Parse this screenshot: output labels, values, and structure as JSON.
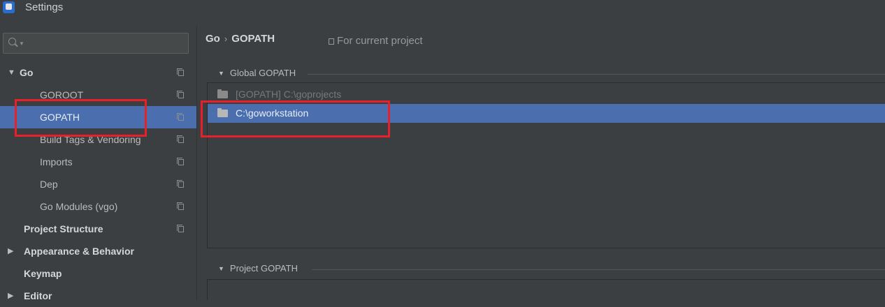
{
  "window": {
    "title": "Settings"
  },
  "sidebar": {
    "search": {
      "placeholder": "",
      "value": ""
    },
    "items": [
      {
        "label": "Go",
        "expanded": true
      },
      {
        "label": "GOROOT"
      },
      {
        "label": "GOPATH",
        "selected": true
      },
      {
        "label": "Build Tags & Vendoring"
      },
      {
        "label": "Imports"
      },
      {
        "label": "Dep"
      },
      {
        "label": "Go Modules (vgo)"
      },
      {
        "label": "Project Structure"
      },
      {
        "label": "Appearance & Behavior",
        "expanded": false
      },
      {
        "label": "Keymap"
      },
      {
        "label": "Editor",
        "expanded": false
      }
    ]
  },
  "main": {
    "breadcrumb": {
      "parent": "Go",
      "separator": "›",
      "current": "GOPATH"
    },
    "scope_label": "For current project",
    "global_section": {
      "title": "Global GOPATH",
      "entries": [
        {
          "path": "[GOPATH] C:\\goprojects",
          "dimmed": true
        },
        {
          "path": "C:\\goworkstation",
          "selected": true
        }
      ]
    },
    "project_section": {
      "title": "Project GOPATH"
    }
  },
  "colors": {
    "background": "#3c3f41",
    "selection": "#4b6eaf",
    "annotation_box": "#e8202a"
  }
}
